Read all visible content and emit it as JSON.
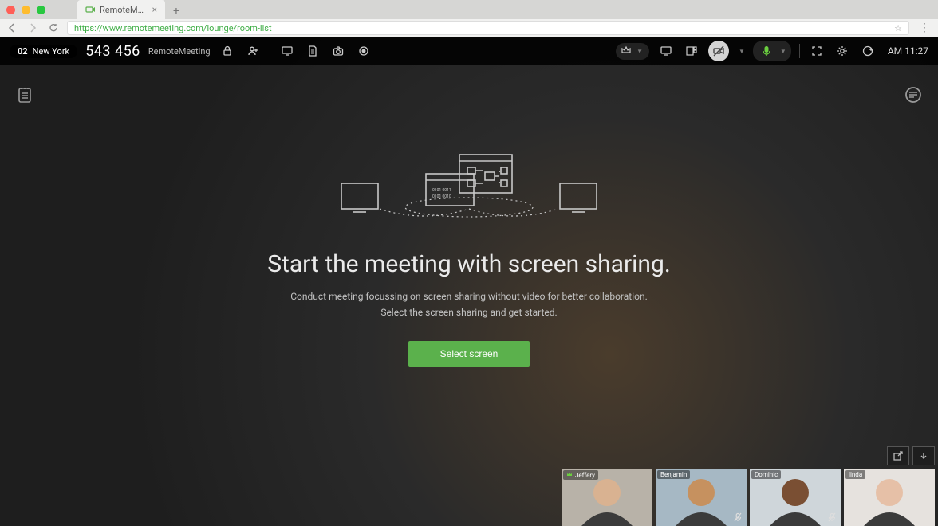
{
  "browser": {
    "tab_title": "RemoteMeeting",
    "url": "https://www.remotemeeting.com/lounge/room-list"
  },
  "topbar": {
    "room_number": "02",
    "room_name": "New York",
    "room_code": "543 456",
    "app_name": "RemoteMeeting",
    "clock": "AM 11:27"
  },
  "main": {
    "heading": "Start the meeting with screen sharing.",
    "desc_line1": "Conduct meeting focussing on screen sharing without video for better collaboration.",
    "desc_line2": "Select the screen sharing and get started.",
    "button_label": "Select screen"
  },
  "participants": [
    {
      "name": "Jeffery",
      "is_host": true,
      "muted": false,
      "bg": "#b8b2a8",
      "skin": "#d9b291"
    },
    {
      "name": "Benjamin",
      "is_host": false,
      "muted": true,
      "bg": "#a6b8c4",
      "skin": "#c6915f"
    },
    {
      "name": "Dominic",
      "is_host": false,
      "muted": true,
      "bg": "#cfd6da",
      "skin": "#7a4f33"
    },
    {
      "name": "linda",
      "is_host": false,
      "muted": false,
      "bg": "#e6e2de",
      "skin": "#e6c0a7"
    }
  ],
  "colors": {
    "accent_green": "#5bb14c"
  }
}
